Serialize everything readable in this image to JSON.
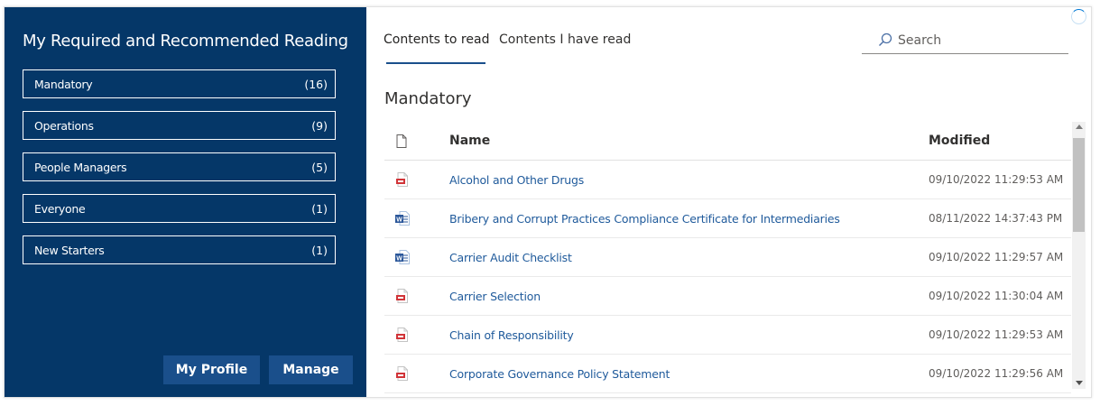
{
  "sidebar": {
    "title": "My Required and Recommended Reading",
    "categories": [
      {
        "label": "Mandatory",
        "count": "(16)"
      },
      {
        "label": "Operations",
        "count": "(9)"
      },
      {
        "label": "People Managers",
        "count": "(5)"
      },
      {
        "label": "Everyone",
        "count": "(1)"
      },
      {
        "label": "New Starters",
        "count": "(1)"
      }
    ],
    "profile_button": "My Profile",
    "manage_button": "Manage"
  },
  "tabs": {
    "to_read": "Contents to read",
    "have_read": "Contents I have read"
  },
  "search": {
    "placeholder": "Search"
  },
  "section_title": "Mandatory",
  "table": {
    "columns": {
      "name": "Name",
      "modified": "Modified"
    },
    "rows": [
      {
        "icon": "pdf-file-icon",
        "name": "Alcohol and Other Drugs",
        "modified": "09/10/2022 11:29:53 AM"
      },
      {
        "icon": "word-file-icon",
        "name": "Bribery and Corrupt Practices Compliance Certificate for Intermediaries",
        "modified": "08/11/2022 14:37:43 PM"
      },
      {
        "icon": "word-file-icon",
        "name": "Carrier Audit Checklist",
        "modified": "09/10/2022 11:29:57 AM"
      },
      {
        "icon": "pdf-file-icon",
        "name": "Carrier Selection",
        "modified": "09/10/2022 11:30:04 AM"
      },
      {
        "icon": "pdf-file-icon",
        "name": "Chain of Responsibility",
        "modified": "09/10/2022 11:29:53 AM"
      },
      {
        "icon": "pdf-file-icon",
        "name": "Corporate Governance Policy Statement",
        "modified": "09/10/2022 11:29:56 AM"
      }
    ]
  },
  "colors": {
    "sidebar_bg": "#053768",
    "button_bg": "#1a4f8b",
    "link": "#1f5a9b",
    "pdf_icon": "#d13438",
    "word_icon": "#2b579a"
  }
}
